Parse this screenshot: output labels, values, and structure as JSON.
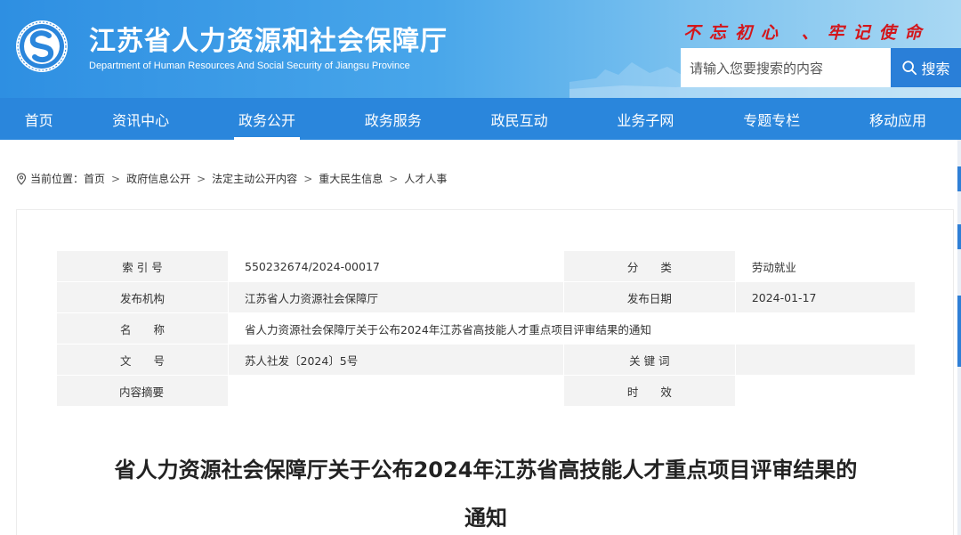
{
  "site": {
    "title": "江苏省人力资源和社会保障厅",
    "subtitle": "Department of Human Resources And Social Security of Jiangsu Province",
    "slogan": "不忘初心 、牢记使命",
    "search_placeholder": "请输入您要搜索的内容",
    "search_label": "搜索"
  },
  "nav": {
    "items": [
      {
        "label": "首页"
      },
      {
        "label": "资讯中心"
      },
      {
        "label": "政务公开"
      },
      {
        "label": "政务服务"
      },
      {
        "label": "政民互动"
      },
      {
        "label": "业务子网"
      },
      {
        "label": "专题专栏"
      },
      {
        "label": "移动应用"
      }
    ],
    "active": "政务公开"
  },
  "breadcrumb": {
    "prefix": "当前位置：",
    "items": [
      "首页",
      "政府信息公开",
      "法定主动公开内容",
      "重大民生信息",
      "人才人事"
    ]
  },
  "info": {
    "index_label": "索 引 号",
    "index_value": "550232674/2024-00017",
    "category_label": "分　　类",
    "category_value": "劳动就业",
    "publisher_label": "发布机构",
    "publisher_value": "江苏省人力资源社会保障厅",
    "date_label": "发布日期",
    "date_value": "2024-01-17",
    "name_label": "名　　称",
    "name_value": "省人力资源社会保障厅关于公布2024年江苏省高技能人才重点项目评审结果的通知",
    "doc_label": "文　　号",
    "doc_value": "苏人社发〔2024〕5号",
    "keywords_label": "关 键 词",
    "keywords_value": "",
    "summary_label": "内容摘要",
    "summary_value": "",
    "validity_label": "时　　效",
    "validity_value": ""
  },
  "article": {
    "title_line1": "省人力资源社会保障厅关于公布2024年江苏省高技能人才重点项目评审结果的",
    "title_line2": "通知"
  }
}
